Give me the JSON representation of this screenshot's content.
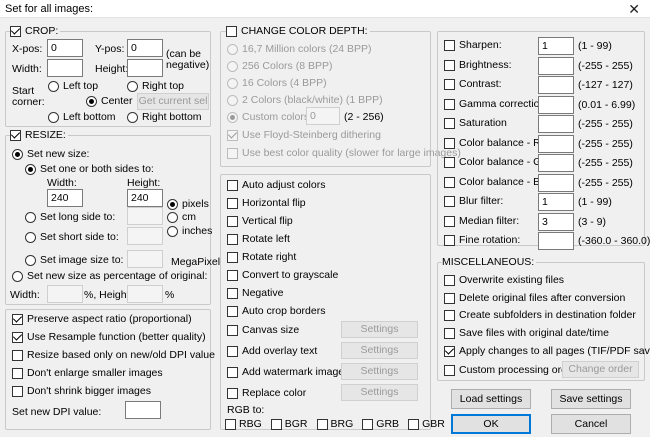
{
  "window": {
    "title": "Set for all images:",
    "close": "✕"
  },
  "crop": {
    "label": "CROP:",
    "xpos_label": "X-pos:",
    "xpos": "0",
    "ypos_label": "Y-pos:",
    "ypos": "0",
    "can_be": "(can be",
    "negative": "negative)",
    "width_label": "Width:",
    "width": "",
    "height_label": "Height:",
    "height": "",
    "start": "Start",
    "corner": "corner:",
    "left_top": "Left top",
    "right_top": "Right top",
    "center": "Center",
    "get_current": "Get current sel",
    "left_bottom": "Left bottom",
    "right_bottom": "Right bottom"
  },
  "resize": {
    "label": "RESIZE:",
    "set_new_size": "Set new size:",
    "set_one_or_both": "Set one or both sides to:",
    "width_label": "Width:",
    "width": "240",
    "height_label": "Height:",
    "height": "240",
    "pixels": "pixels",
    "cm": "cm",
    "inches": "inches",
    "set_long": "Set long side to:",
    "set_short": "Set short side to:",
    "set_image_size": "Set image size to:",
    "megapixel": "MegaPixel",
    "percentage": "Set new size as percentage of original:",
    "pct_width_label": "Width:",
    "pct_mid": "%, Height:",
    "pct_end": "%"
  },
  "options": {
    "preserve": "Preserve aspect ratio (proportional)",
    "resample": "Use Resample function (better quality)",
    "dpi_only": "Resize based only on new/old DPI value",
    "dont_enlarge": "Don't enlarge smaller images",
    "dont_shrink": "Don't shrink bigger images",
    "dpi_label": "Set new DPI value:",
    "dpi_value": ""
  },
  "color_depth": {
    "label": "CHANGE COLOR DEPTH:",
    "c24": "16,7 Million colors (24 BPP)",
    "c8": "256 Colors (8 BPP)",
    "c4": "16 Colors (4 BPP)",
    "c1": "2 Colors (black/white) (1 BPP)",
    "custom": "Custom colors:",
    "custom_value": "0",
    "custom_range": "(2 - 256)",
    "floyd": "Use Floyd-Steinberg dithering",
    "best": "Use best color quality (slower for large images)"
  },
  "transforms": {
    "auto_adjust": "Auto adjust colors",
    "hflip": "Horizontal flip",
    "vflip": "Vertical flip",
    "rot_left": "Rotate left",
    "rot_right": "Rotate right",
    "grayscale": "Convert to grayscale",
    "negative": "Negative",
    "autocrop": "Auto crop borders",
    "canvas": "Canvas size",
    "overlay": "Add overlay text",
    "watermark": "Add watermark image",
    "replace": "Replace color",
    "settings": "Settings",
    "rgb_to": "RGB to:",
    "rbg": "RBG",
    "bgr": "BGR",
    "brg": "BRG",
    "grb": "GRB",
    "gbr": "GBR"
  },
  "adjust": {
    "rows": [
      {
        "label": "Sharpen:",
        "value": "1",
        "range": "(1  -  99)"
      },
      {
        "label": "Brightness:",
        "value": "",
        "range": "(-255  -  255)"
      },
      {
        "label": "Contrast:",
        "value": "",
        "range": "(-127  -  127)"
      },
      {
        "label": "Gamma correction:",
        "value": "",
        "range": "(0.01  -  6.99)"
      },
      {
        "label": "Saturation",
        "value": "",
        "range": "(-255  -  255)"
      },
      {
        "label": "Color balance - R:",
        "value": "",
        "range": "(-255  -  255)"
      },
      {
        "label": "Color balance - G:",
        "value": "",
        "range": "(-255  -  255)"
      },
      {
        "label": "Color balance - B:",
        "value": "",
        "range": "(-255  -  255)"
      },
      {
        "label": "Blur filter:",
        "value": "1",
        "range": "(1  -  99)"
      },
      {
        "label": "Median filter:",
        "value": "3",
        "range": "(3  -  9)"
      },
      {
        "label": "Fine rotation:",
        "value": "",
        "range": "(-360.0  -  360.0)"
      }
    ]
  },
  "misc": {
    "label": "MISCELLANEOUS:",
    "overwrite": "Overwrite existing files",
    "delete_orig": "Delete original files after conversion",
    "subfolders": "Create subfolders in destination folder",
    "save_date": "Save files with original date/time",
    "apply_all": "Apply changes to all pages (TIF/PDF saving)",
    "custom_order": "Custom processing order",
    "change_order": "Change order"
  },
  "buttons": {
    "load": "Load settings",
    "save": "Save settings",
    "ok": "OK",
    "cancel": "Cancel"
  }
}
